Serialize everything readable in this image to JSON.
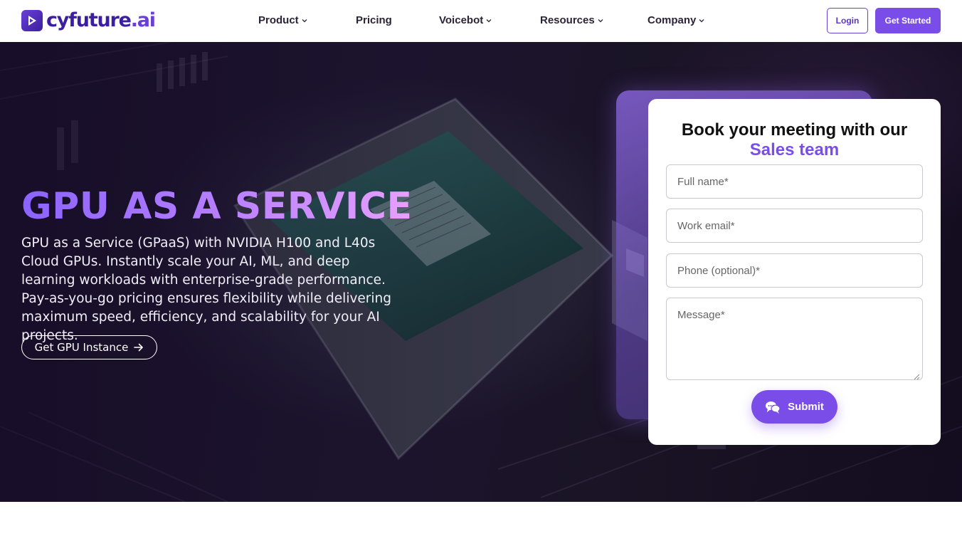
{
  "brand": {
    "name": "cyfuture",
    "suffix": ".ai",
    "logo_icon": "play-triangle-icon",
    "colors": {
      "primary": "#7b4de8",
      "dark": "#3b1fa0"
    }
  },
  "nav": {
    "items": [
      {
        "label": "Product",
        "has_dropdown": true
      },
      {
        "label": "Pricing",
        "has_dropdown": false
      },
      {
        "label": "Voicebot",
        "has_dropdown": true
      },
      {
        "label": "Resources",
        "has_dropdown": true
      },
      {
        "label": "Company",
        "has_dropdown": true
      }
    ],
    "login_label": "Login",
    "cta_label": "Get Started"
  },
  "hero": {
    "title": "GPU AS A SERVICE",
    "description": "GPU as a Service (GPaaS) with NVIDIA H100 and L40s Cloud GPUs. Instantly scale your AI, ML, and deep learning workloads with enterprise-grade performance. Pay-as-you-go pricing ensures flexibility while delivering maximum speed, efficiency, and scalability for your AI projects.",
    "button_label": "Get GPU Instance",
    "button_icon": "arrow-right-icon"
  },
  "form": {
    "title_line1": "Book your meeting with our",
    "title_highlight": "Sales team",
    "fields": {
      "full_name": {
        "placeholder": "Full name*",
        "value": ""
      },
      "email": {
        "placeholder": "Work email*",
        "value": ""
      },
      "phone": {
        "placeholder": "Phone (optional)*",
        "value": ""
      },
      "message": {
        "placeholder": "Message*",
        "value": ""
      }
    },
    "submit_label": "Submit",
    "submit_icon": "chat-bubbles-icon"
  }
}
